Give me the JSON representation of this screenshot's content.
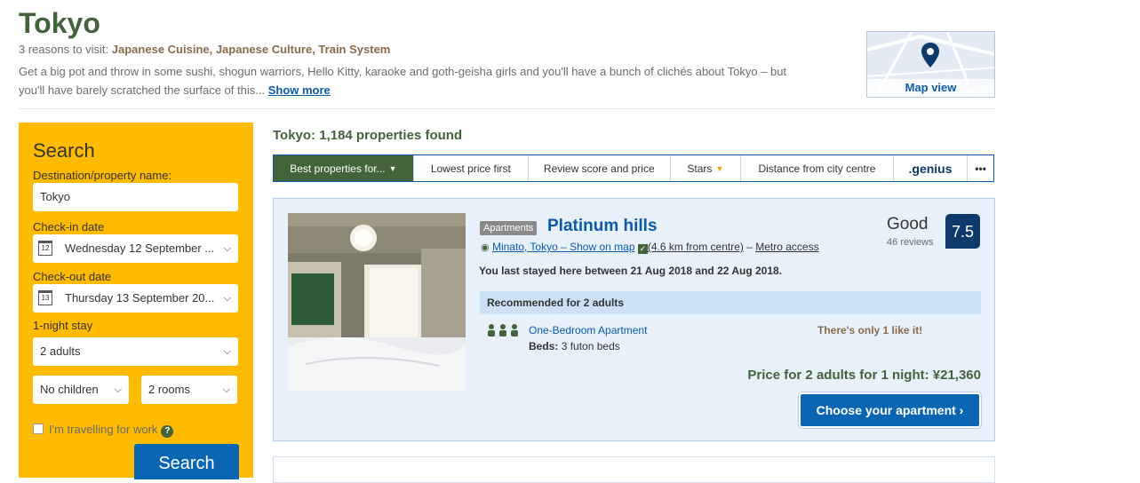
{
  "header": {
    "city": "Tokyo",
    "reasons_prefix": "3 reasons to visit: ",
    "reasons": "Japanese Cuisine, Japanese Culture, Train System",
    "intro_line1": "Get a big pot and throw in some sushi, shogun warriors, Hello Kitty, karaoke and goth-geisha girls and you'll have a bunch of clichés about Tokyo – but",
    "intro_line2": "you'll have barely scratched the surface of this...",
    "show_more": "Show more",
    "map_view": "Map view"
  },
  "search": {
    "title": "Search",
    "destination_label": "Destination/property name:",
    "destination_value": "Tokyo",
    "checkin_label": "Check-in date",
    "checkin_value": "Wednesday 12 September ...",
    "checkin_day": "12",
    "checkout_label": "Check-out date",
    "checkout_value": "Thursday 13 September 20...",
    "checkout_day": "13",
    "stay_length": "1-night stay",
    "adults": "2 adults",
    "children": "No children",
    "rooms": "2 rooms",
    "work_travel": "I'm travelling for work",
    "help": "?",
    "button": "Search"
  },
  "results": {
    "count_text": "Tokyo: 1,184 properties found",
    "sort_tabs": [
      {
        "label": "Best properties for..."
      },
      {
        "label": "Lowest price first"
      },
      {
        "label": "Review score and price"
      },
      {
        "label": "Stars"
      },
      {
        "label": "Distance from city centre"
      },
      {
        "label": ".genius"
      },
      {
        "label": "•••"
      }
    ]
  },
  "property": {
    "type_badge": "Apartments",
    "name": "Platinum hills",
    "location": "Minato, Tokyo – Show on map",
    "distance": "(4.6 km from centre)",
    "dash": " – ",
    "metro": "Metro access",
    "last_stay": "You last stayed here between 21 Aug 2018 and 22 Aug 2018.",
    "score_word": "Good",
    "reviews": "46 reviews",
    "score": "7.5",
    "recommended": "Recommended for 2 adults",
    "room_name": "One-Bedroom Apartment",
    "beds_label": "Beds:",
    "beds_value": "3 futon beds",
    "availability": "There's only 1 like it!",
    "price": "Price for 2 adults for 1 night: ¥21,360",
    "cta": "Choose your apartment",
    "cta_arrow": "›"
  },
  "icons": {
    "map_pin": "map-pin-icon",
    "calendar": "calendar-icon",
    "chevron": "chevron-down-icon",
    "people": "people-icon",
    "location_pin": "location-pin-icon",
    "check": "check-icon"
  },
  "colors": {
    "brand_green": "#43633a",
    "link_blue": "#0a5aa8",
    "search_yellow": "#febb02",
    "button_blue": "#0a65b3",
    "score_navy": "#0b3a6b"
  }
}
